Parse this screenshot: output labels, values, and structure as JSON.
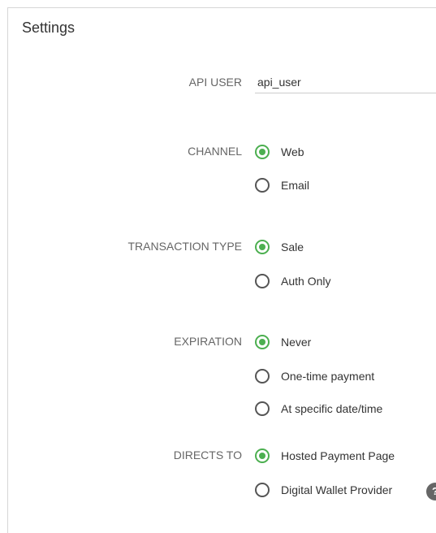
{
  "settings": {
    "title": "Settings",
    "api_user": {
      "label": "API USER",
      "value": "api_user"
    },
    "channel": {
      "label": "CHANNEL",
      "options": [
        {
          "label": "Web",
          "checked": true
        },
        {
          "label": "Email",
          "checked": false
        }
      ]
    },
    "transaction_type": {
      "label": "TRANSACTION TYPE",
      "options": [
        {
          "label": "Sale",
          "checked": true
        },
        {
          "label": "Auth Only",
          "checked": false
        }
      ]
    },
    "expiration": {
      "label": "EXPIRATION",
      "options": [
        {
          "label": "Never",
          "checked": true
        },
        {
          "label": "One-time payment",
          "checked": false
        },
        {
          "label": "At specific date/time",
          "checked": false
        }
      ]
    },
    "directs_to": {
      "label": "DIRECTS TO",
      "options": [
        {
          "label": "Hosted Payment Page",
          "checked": true
        },
        {
          "label": "Digital Wallet Provider",
          "checked": false
        }
      ]
    }
  },
  "icons": {
    "help": "help-circle-icon"
  },
  "colors": {
    "accent": "#4caf50",
    "label": "#666666",
    "text": "#333333",
    "border": "#d6d6d6"
  }
}
